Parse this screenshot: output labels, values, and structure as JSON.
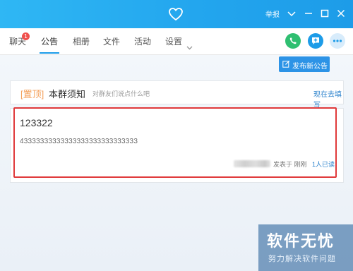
{
  "titlebar": {
    "report_label": "举报",
    "icons": [
      "heart-icon",
      "chevron-down-icon",
      "minimize-icon",
      "maximize-icon",
      "close-icon"
    ]
  },
  "tabs": {
    "items": [
      {
        "label": "聊天",
        "badge": "1"
      },
      {
        "label": "公告",
        "active": true
      },
      {
        "label": "相册"
      },
      {
        "label": "文件"
      },
      {
        "label": "活动"
      },
      {
        "label": "设置"
      }
    ],
    "actions": [
      {
        "icon": "phone-icon",
        "color": "#2fbf71"
      },
      {
        "icon": "add-notice-icon",
        "color": "#1d9ce8"
      },
      {
        "icon": "more-icon",
        "color": "#1d9ce8"
      }
    ]
  },
  "toolbar": {
    "publish_label": "发布新公告",
    "accent": "#2c93e6"
  },
  "pinned": {
    "tag": "[置顶]",
    "title": "本群须知",
    "hint": "对群友们说点什么吧",
    "link": "现在去填写"
  },
  "notice": {
    "title": "123322",
    "body": "43333333333333333333333333333",
    "published_label": "发表于 刚刚",
    "read_label": "1人已读"
  },
  "watermark": {
    "main": "软件无忧",
    "sub": "努力解决软件问题"
  },
  "colors": {
    "titlebar": "#23a6ee",
    "highlight_border": "#e0393b",
    "link": "#2b82cc",
    "pin_tag": "#f4a15c"
  }
}
